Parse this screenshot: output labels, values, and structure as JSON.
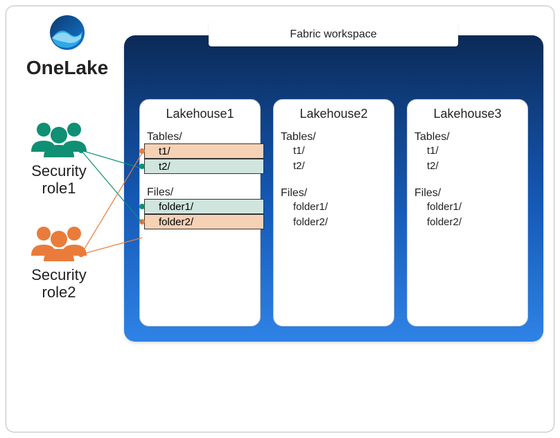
{
  "onelake": {
    "label": "OneLake"
  },
  "roles": {
    "role1": {
      "label_line1": "Security",
      "label_line2": "role1",
      "color": "#0f8f74"
    },
    "role2": {
      "label_line1": "Security",
      "label_line2": "role2",
      "color": "#e97c3a"
    }
  },
  "workspace": {
    "title": "Fabric workspace",
    "lakehouses": [
      {
        "name": "Lakehouse1",
        "tables_label": "Tables/",
        "tables": [
          "t1/",
          "t2/"
        ],
        "files_label": "Files/",
        "files": [
          "folder1/",
          "folder2/"
        ],
        "highlights": {
          "t1": "orange",
          "t2": "teal",
          "folder1": "teal",
          "folder2": "orange"
        }
      },
      {
        "name": "Lakehouse2",
        "tables_label": "Tables/",
        "tables": [
          "t1/",
          "t2/"
        ],
        "files_label": "Files/",
        "files": [
          "folder1/",
          "folder2/"
        ]
      },
      {
        "name": "Lakehouse3",
        "tables_label": "Tables/",
        "tables": [
          "t1/",
          "t2/"
        ],
        "files_label": "Files/",
        "files": [
          "folder1/",
          "folder2/"
        ]
      }
    ]
  },
  "connections": {
    "role1_to": [
      "lakehouse1.tables.t2",
      "lakehouse1.files.folder1"
    ],
    "role2_to": [
      "lakehouse1.tables.t1",
      "lakehouse1.files.folder2"
    ]
  }
}
